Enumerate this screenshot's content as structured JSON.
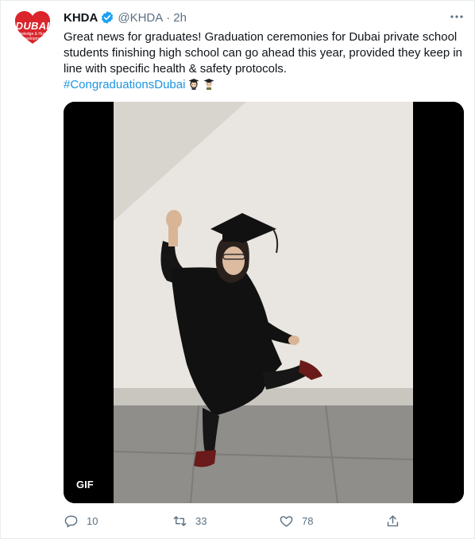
{
  "tweet": {
    "author_name": "KHDA",
    "handle": "@KHDA",
    "separator": "·",
    "time": "2h",
    "avatar": {
      "brand_text": "DUBAI",
      "tagline": "Knowledge & Human Development",
      "color": "#d9252b",
      "icon": "heart-logo"
    },
    "verified_icon": "verified-badge-icon",
    "more_icon": "more-options-icon",
    "text": "Great news for graduates! Graduation ceremonies for Dubai private school students finishing high school can go ahead this year, provided they keep in line with specific health & safety protocols.",
    "hashtag": "#CongraduationsDubai",
    "emojis": [
      "woman-student-emoji",
      "man-student-emoji"
    ],
    "media": {
      "type": "GIF",
      "badge": "GIF"
    },
    "actions": {
      "reply": {
        "icon": "reply-icon",
        "count": "10"
      },
      "retweet": {
        "icon": "retweet-icon",
        "count": "33"
      },
      "like": {
        "icon": "heart-icon",
        "count": "78"
      },
      "share": {
        "icon": "share-icon"
      }
    },
    "colors": {
      "link": "#1b95e0",
      "verified": "#1da1f2",
      "secondary_text": "#5b7083"
    }
  }
}
